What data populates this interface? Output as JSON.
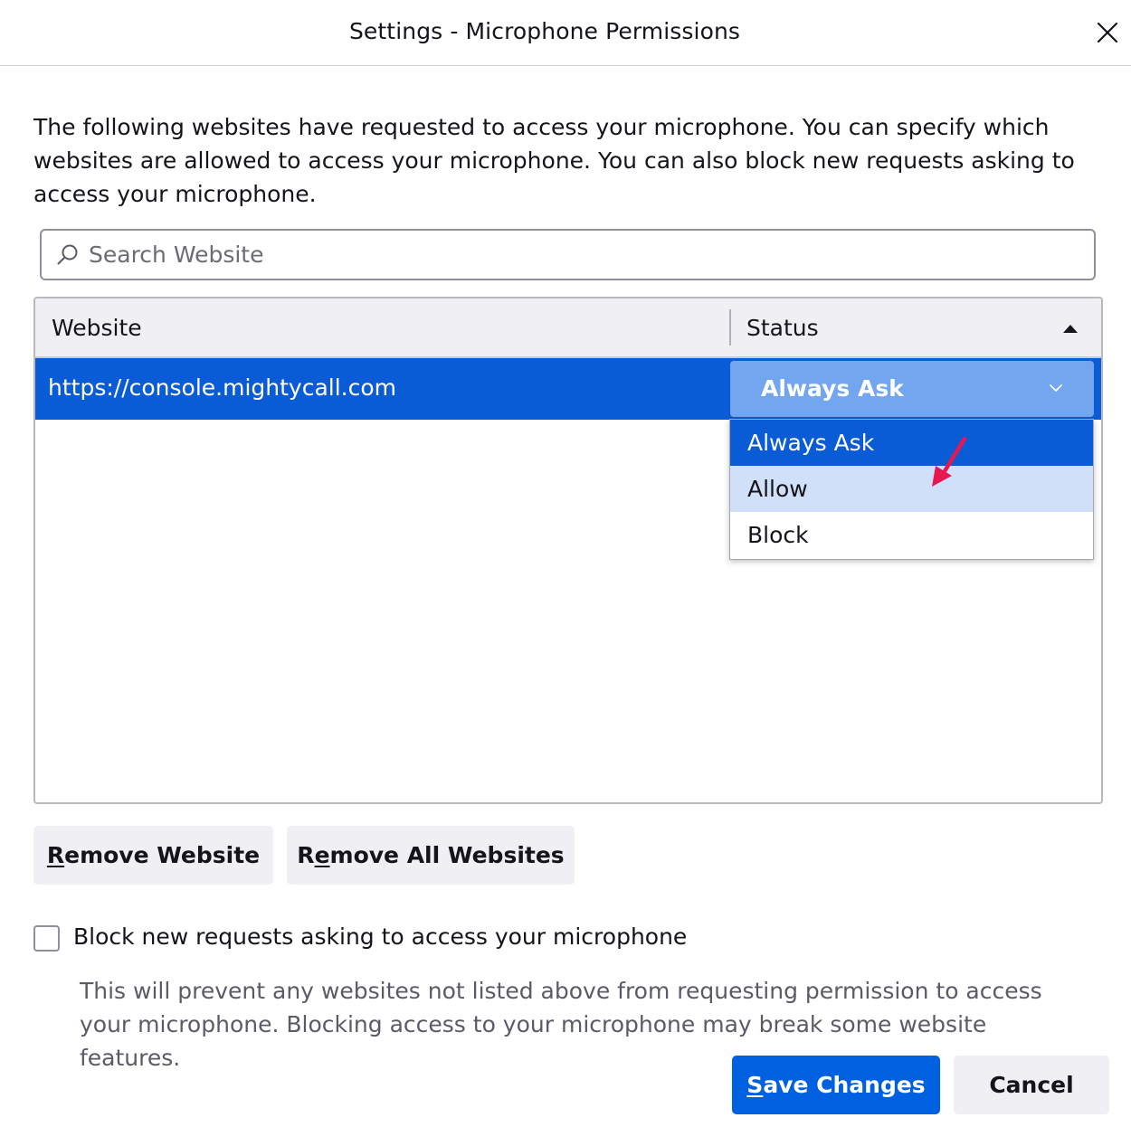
{
  "dialog": {
    "title": "Settings - Microphone Permissions",
    "intro": "The following websites have requested to access your microphone. You can specify which websites are allowed to access your microphone. You can also block new requests asking to access your microphone."
  },
  "search": {
    "placeholder": "Search Website",
    "value": ""
  },
  "table": {
    "columns": {
      "website": "Website",
      "status": "Status"
    },
    "rows": [
      {
        "website": "https://console.mightycall.com",
        "status": "Always Ask"
      }
    ]
  },
  "status_dropdown": {
    "options": [
      "Always Ask",
      "Allow",
      "Block"
    ],
    "selected": "Always Ask",
    "hovered": "Allow"
  },
  "buttons": {
    "remove_website": {
      "accel": "R",
      "rest": "emove Website"
    },
    "remove_all": {
      "pre": "R",
      "accel": "e",
      "rest": "move All Websites"
    },
    "save": {
      "accel": "S",
      "rest": "ave Changes"
    },
    "cancel": "Cancel"
  },
  "block_option": {
    "label": "Block new requests asking to access your microphone",
    "checked": false,
    "description": "This will prevent any websites not listed above from requesting permission to access your microphone. Blocking access to your microphone may break some website features."
  },
  "colors": {
    "accent": "#0061e0",
    "row_selected": "#0a5cd6",
    "option_hover": "#cfe0f8",
    "annotation_arrow": "#e8174f"
  },
  "icons": {
    "close": "close-icon",
    "search": "search-icon",
    "sort": "sort-ascending-icon",
    "chevron": "chevron-down-icon"
  }
}
